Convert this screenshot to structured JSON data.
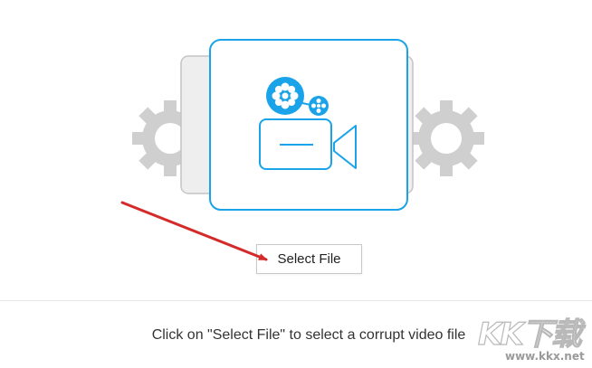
{
  "illustration": {
    "icon": "video-camera-film-reel-icon",
    "side_icons": "gear-icon",
    "accent_color": "#1aa3e8",
    "gear_color": "#cfcfcf"
  },
  "select_file": {
    "label": "Select File"
  },
  "hint": {
    "text": "Click on \"Select File\" to select a corrupt video file"
  },
  "annotation": {
    "arrow_color": "#d42a2a"
  },
  "watermark": {
    "mark": "KK下载",
    "url": "www.kkx.net"
  }
}
